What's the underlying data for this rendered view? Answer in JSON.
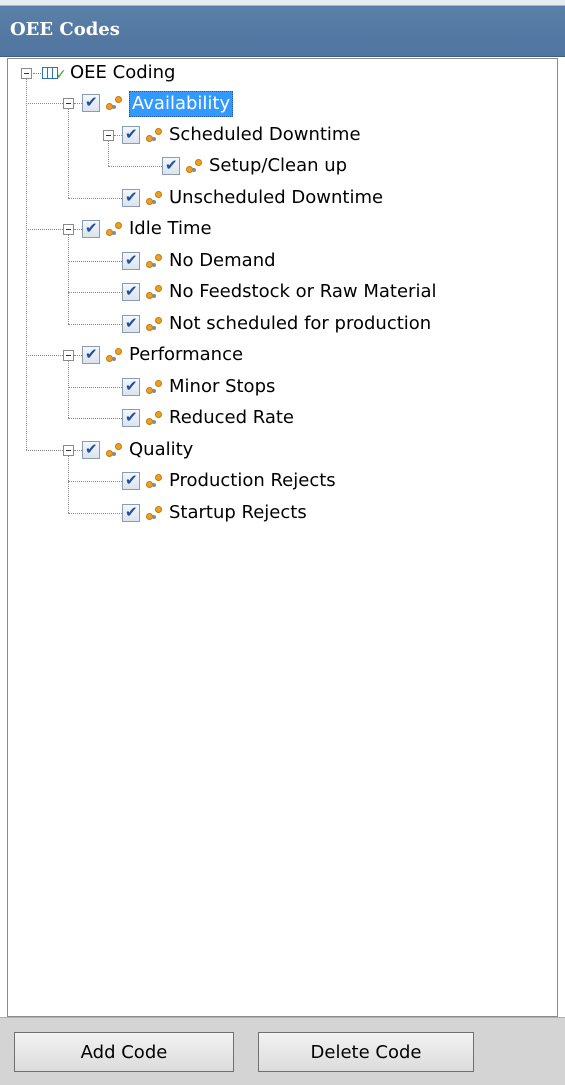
{
  "panel": {
    "title": "OEE Codes"
  },
  "tree": {
    "root": {
      "label": "OEE Coding",
      "icon": "table-check-icon"
    },
    "selected_label": "Availability",
    "nodes": [
      {
        "label": "Availability",
        "checked": true,
        "icon": "code-nodes-icon",
        "children": [
          {
            "label": "Scheduled Downtime",
            "checked": true,
            "icon": "code-nodes-icon",
            "children": [
              {
                "label": "Setup/Clean up",
                "checked": true,
                "icon": "code-nodes-icon"
              }
            ]
          },
          {
            "label": "Unscheduled Downtime",
            "checked": true,
            "icon": "code-nodes-icon"
          }
        ]
      },
      {
        "label": "Idle Time",
        "checked": true,
        "icon": "code-nodes-icon",
        "children": [
          {
            "label": "No Demand",
            "checked": true,
            "icon": "code-nodes-icon"
          },
          {
            "label": "No Feedstock or Raw Material",
            "checked": true,
            "icon": "code-nodes-icon"
          },
          {
            "label": "Not scheduled for production",
            "checked": true,
            "icon": "code-nodes-icon"
          }
        ]
      },
      {
        "label": "Performance",
        "checked": true,
        "icon": "code-nodes-icon",
        "children": [
          {
            "label": "Minor Stops",
            "checked": true,
            "icon": "code-nodes-icon"
          },
          {
            "label": "Reduced Rate",
            "checked": true,
            "icon": "code-nodes-icon"
          }
        ]
      },
      {
        "label": "Quality",
        "checked": true,
        "icon": "code-nodes-icon",
        "children": [
          {
            "label": "Production Rejects",
            "checked": true,
            "icon": "code-nodes-icon"
          },
          {
            "label": "Startup Rejects",
            "checked": true,
            "icon": "code-nodes-icon"
          }
        ]
      }
    ]
  },
  "buttons": {
    "add": "Add Code",
    "delete": "Delete Code"
  },
  "colors": {
    "title_bar": "#4f75a0",
    "selection": "#3399ff",
    "node_icon": "#f0a020",
    "footer": "#d4d4d4"
  }
}
